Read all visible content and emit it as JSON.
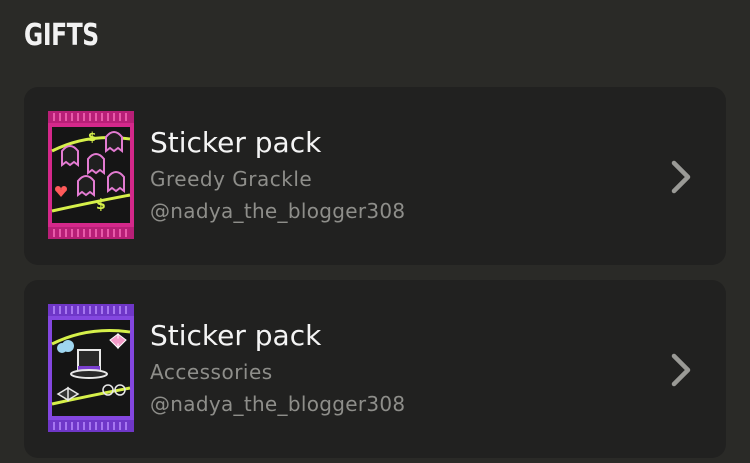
{
  "section": {
    "title": "GIFTS"
  },
  "gifts": [
    {
      "name": "Sticker pack",
      "collection": "Greedy Grackle",
      "sender": "@nadya_the_blogger308",
      "accent": "#e0318f"
    },
    {
      "name": "Sticker pack",
      "collection": "Accessories",
      "sender": "@nadya_the_blogger308",
      "accent": "#8a4de6"
    }
  ],
  "icons": {
    "pack": "sticker-pack-icon",
    "chevron": "chevron-right-icon"
  },
  "colors": {
    "background": "#2a2a27",
    "card": "#212120",
    "muted_text": "#8e8e8a"
  }
}
